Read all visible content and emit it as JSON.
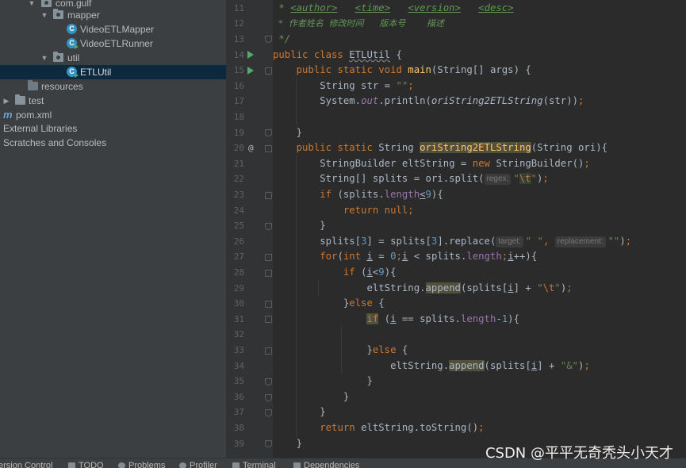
{
  "project_tree": {
    "items": [
      {
        "label": "com.gulf",
        "kind": "package",
        "expanded": true
      },
      {
        "label": "mapper",
        "kind": "package",
        "expanded": true
      },
      {
        "label": "VideoETLMapper",
        "kind": "class"
      },
      {
        "label": "VideoETLRunner",
        "kind": "class-run"
      },
      {
        "label": "util",
        "kind": "package",
        "expanded": true
      },
      {
        "label": "ETLUtil",
        "kind": "class-run",
        "selected": true
      },
      {
        "label": "resources",
        "kind": "resources-folder"
      },
      {
        "label": "test",
        "kind": "folder",
        "expanded": false
      },
      {
        "label": "pom.xml",
        "kind": "maven"
      },
      {
        "label": "External Libraries",
        "kind": "libraries"
      },
      {
        "label": "Scratches and Consoles",
        "kind": "scratches"
      }
    ]
  },
  "gutter": {
    "line_numbers": [
      "11",
      "12",
      "13",
      "14",
      "15",
      "16",
      "17",
      "18",
      "19",
      "20",
      "21",
      "22",
      "23",
      "24",
      "25",
      "26",
      "27",
      "28",
      "29",
      "30",
      "31",
      "32",
      "33",
      "34",
      "35",
      "36",
      "37",
      "38",
      "39"
    ]
  },
  "code": {
    "l11": {
      "a": " * ",
      "b": "<author>",
      "c": "   ",
      "d": "<time>",
      "e": "   ",
      "f": "<version>",
      "g": "   ",
      "h": "<desc>"
    },
    "l12": {
      "a": " * 作者姓名 修改时间   版本号    描述"
    },
    "l13": {
      "a": " */"
    },
    "l14": {
      "kw1": "public class ",
      "name": "ETLUtil",
      "rest": " {"
    },
    "l15": {
      "ind": "    ",
      "kw1": "public static void ",
      "fn": "main",
      "rest": "(String[] args) {"
    },
    "l16": {
      "ind": "        ",
      "a": "String str = ",
      "s": "\"\"",
      "end": ";"
    },
    "l17": {
      "ind": "        ",
      "a": "System.",
      "out": "out",
      "b": ".println(",
      "call": "oriString2ETLString",
      "c": "(str))",
      "end": ";"
    },
    "l19": {
      "ind": "    ",
      "a": "}"
    },
    "l20": {
      "ind": "    ",
      "kw1": "public static ",
      "a": "String ",
      "fn": "oriString2ETLString",
      "rest": "(String ori){"
    },
    "l21": {
      "ind": "        ",
      "a": "StringBuilder eltString = ",
      "kw": "new ",
      "b": "StringBuilder()",
      "end": ";"
    },
    "l22": {
      "ind": "        ",
      "a": "String[] splits = ori.split(",
      "hint": "regex:",
      "s1": "\"",
      "esc": "\\t",
      "s2": "\"",
      "b": ")",
      "end": ";"
    },
    "l23": {
      "ind": "        ",
      "kw": "if ",
      "a": "(splits.",
      "f": "length",
      "op": "<",
      "n": "9",
      "b": "){"
    },
    "l24": {
      "ind": "            ",
      "kw": "return null",
      "end": ";"
    },
    "l25": {
      "ind": "        ",
      "a": "}"
    },
    "l26": {
      "ind": "        ",
      "a": "splits[",
      "n1": "3",
      "b": "] = splits[",
      "n2": "3",
      "c": "].replace(",
      "hint1": "target:",
      "s1": "\" \"",
      "comma": ", ",
      "hint2": "replacement:",
      "s2": "\"\"",
      "d": ")",
      "end": ";"
    },
    "l27": {
      "ind": "        ",
      "kw1": "for",
      "a": "(",
      "kw2": "int ",
      "v1": "i",
      "b": " = ",
      "n": "0",
      "semi1": ";",
      "v2": "i",
      "c": " < splits.",
      "f": "length",
      "semi2": ";",
      "v3": "i",
      "d": "++){"
    },
    "l28": {
      "ind": "            ",
      "kw": "if ",
      "a": "(",
      "v": "i",
      "b": "<",
      "n": "9",
      "c": "){"
    },
    "l29": {
      "ind": "                ",
      "a": "eltString.",
      "call": "append",
      "b": "(splits[",
      "v": "i",
      "c": "] + ",
      "s1": "\"",
      "esc": "\\t",
      "s2": "\"",
      "d": ")",
      "end": ";"
    },
    "l30": {
      "ind": "            ",
      "a": "}",
      "kw": "else ",
      "b": "{"
    },
    "l31": {
      "ind": "                ",
      "kw": "if",
      "a": " (",
      "v": "i",
      "b": " == splits.",
      "f": "length",
      "c": "-",
      "n": "1",
      "d": "){"
    },
    "l33": {
      "ind": "                ",
      "a": "}",
      "kw": "else ",
      "b": "{"
    },
    "l34": {
      "ind": "                    ",
      "a": "eltString.",
      "call": "append",
      "b": "(splits[",
      "v": "i",
      "c": "] + ",
      "s": "\"&\"",
      "d": ")",
      "end": ";"
    },
    "l35": {
      "ind": "                ",
      "a": "}"
    },
    "l36": {
      "ind": "            ",
      "a": "}"
    },
    "l37": {
      "ind": "        ",
      "a": "}"
    },
    "l38": {
      "ind": "        ",
      "kw": "return ",
      "a": "eltString.toString()",
      "end": ";"
    },
    "l39": {
      "ind": "    ",
      "a": "}"
    }
  },
  "bottom_bar": {
    "tabs": [
      "ersion Control",
      "TODO",
      "Problems",
      "Profiler",
      "Terminal",
      "Dependencies"
    ]
  },
  "watermark": "CSDN @平平无奇秃头小天才",
  "colors": {
    "editor_bg": "#2b2b2b",
    "tree_bg": "#3c3f41",
    "keyword": "#cc7832",
    "string": "#6a8759",
    "function": "#ffc66d",
    "number": "#6897bb",
    "comment": "#629755",
    "static_field": "#9876aa",
    "selection": "#0d293e"
  }
}
